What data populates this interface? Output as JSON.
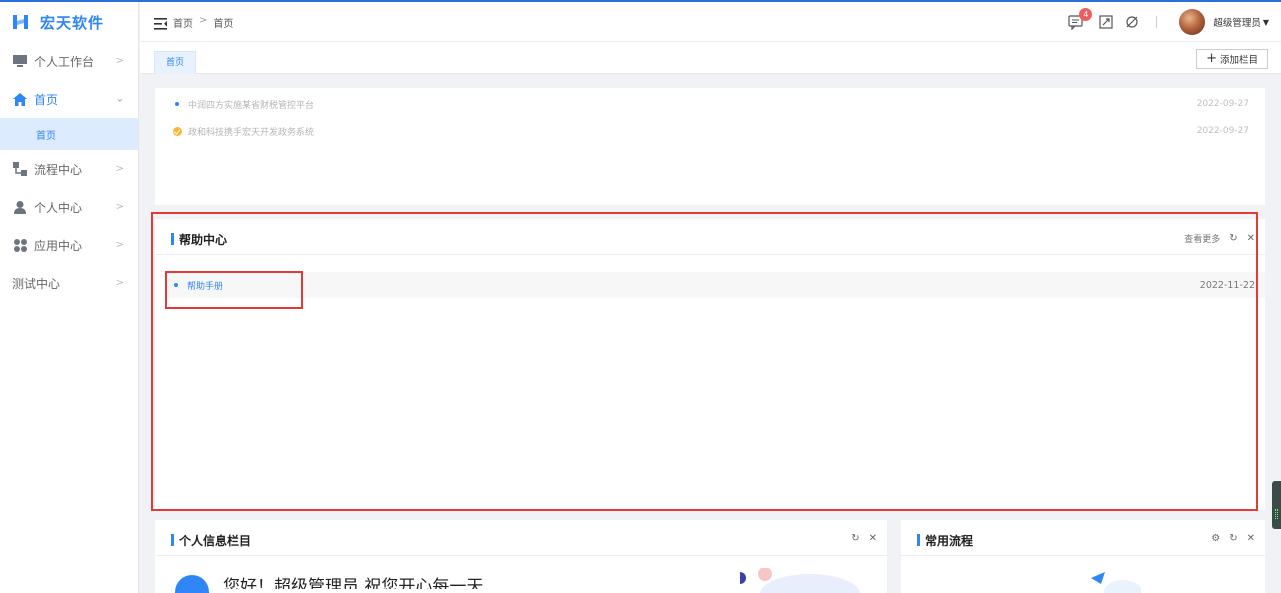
{
  "app": {
    "name": "宏天软件"
  },
  "sidebar": {
    "items": [
      {
        "label": "个人工作台",
        "icon": "monitor-icon"
      },
      {
        "label": "首页",
        "icon": "home-icon",
        "active": true,
        "children": [
          {
            "label": "首页"
          }
        ]
      },
      {
        "label": "流程中心",
        "icon": "flow-icon"
      },
      {
        "label": "个人中心",
        "icon": "user-icon"
      },
      {
        "label": "应用中心",
        "icon": "apps-icon"
      },
      {
        "label": "测试中心",
        "icon": ""
      }
    ]
  },
  "header": {
    "breadcrumb": [
      "首页",
      ">",
      "首页"
    ],
    "message_count": "4",
    "username": "超级管理员"
  },
  "tabs": {
    "items": [
      {
        "label": "首页"
      }
    ],
    "add_column_label": "添加栏目"
  },
  "news": {
    "items": [
      {
        "title": "中润四方实施某省财税管控平台",
        "date": "2022-09-27"
      },
      {
        "title": "政和科技携手宏天开发政务系统",
        "date": "2022-09-27"
      }
    ]
  },
  "help_center": {
    "title": "帮助中心",
    "more_label": "查看更多",
    "items": [
      {
        "title": "帮助手册",
        "date": "2022-11-22"
      }
    ]
  },
  "personal_info": {
    "title": "个人信息栏目",
    "welcome": "您好！超级管理员 祝您开心每一天"
  },
  "common_process": {
    "title": "常用流程"
  },
  "colors": {
    "accent": "#2f86f6",
    "annotation": "#e53935",
    "badge": "#f25b5b"
  }
}
